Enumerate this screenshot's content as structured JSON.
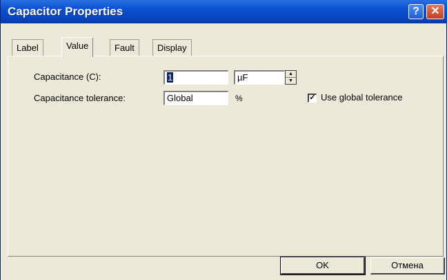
{
  "window": {
    "title": "Capacitor Properties"
  },
  "titlebar": {
    "help_glyph": "?",
    "close_glyph": "✕",
    "help_icon": "help-icon",
    "close_icon": "close-icon"
  },
  "tabs": [
    {
      "label": "Label",
      "active": false
    },
    {
      "label": "Value",
      "active": true
    },
    {
      "label": "Fault",
      "active": false
    },
    {
      "label": "Display",
      "active": false
    }
  ],
  "value_tab": {
    "capacitance_label": "Capacitance (C):",
    "capacitance_value": "1",
    "capacitance_unit": "µF",
    "tolerance_label": "Capacitance tolerance:",
    "tolerance_value": "Global",
    "tolerance_unit": "%",
    "use_global_tolerance_label": "Use global tolerance",
    "use_global_tolerance_checked": true,
    "check_glyph": "✓"
  },
  "buttons": {
    "ok": "OK",
    "cancel": "Отмена"
  },
  "colors": {
    "titlebar": "#0a52d4",
    "dialog_bg": "#ece9d8",
    "close_button": "#c0401f"
  }
}
